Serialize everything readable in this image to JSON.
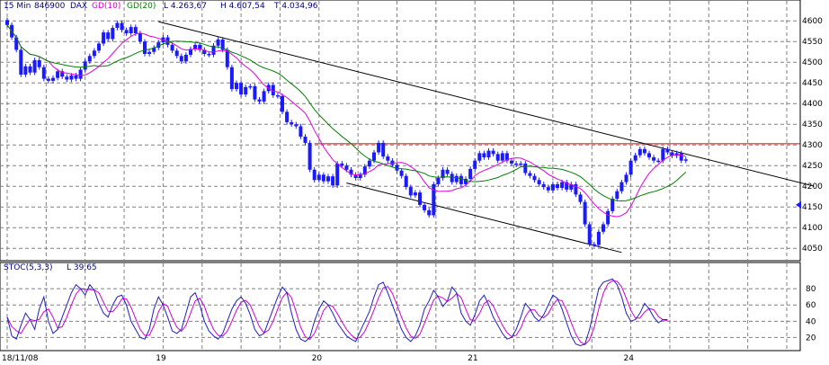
{
  "header": {
    "interval": "15 Min",
    "symbol_code": "846900",
    "symbol": "DAX",
    "ma1_label": "GD(10)",
    "ma2_label": "GD(20)",
    "low": "L  4.263,67",
    "high": "H  4.607,54",
    "low2": "T  4.034,96"
  },
  "oscillator_header": {
    "name": "STOC(5,3,3)",
    "value": "L  39,65"
  },
  "colors": {
    "price_bars": "#1a1aff",
    "ma_short": "#e000e0",
    "ma_long": "#008000",
    "resistance": "#e00000",
    "trend": "#000000",
    "grid": "#808080",
    "stoch_k": "#2020c0",
    "stoch_d": "#d000d0",
    "marker": "#1a1aff"
  },
  "chart_data": [
    {
      "type": "line",
      "panel": "price",
      "ylim": [
        4020,
        4620
      ],
      "y_ticks": [
        "4600",
        "4550",
        "4500",
        "4450",
        "4400",
        "4350",
        "4300",
        "4250",
        "4200",
        "4150",
        "4100",
        "4050"
      ],
      "y_tick_values": [
        4600,
        4550,
        4500,
        4450,
        4400,
        4350,
        4300,
        4250,
        4200,
        4150,
        4100,
        4050
      ],
      "x_ticks": [
        {
          "label": "18/11/08",
          "t": 0
        },
        {
          "label": "19",
          "t": 33
        },
        {
          "label": "20",
          "t": 67
        },
        {
          "label": "21",
          "t": 101
        },
        {
          "label": "24",
          "t": 135
        }
      ],
      "grid": true,
      "close": [
        4590,
        4560,
        4530,
        4470,
        4490,
        4475,
        4505,
        4488,
        4460,
        4455,
        4462,
        4478,
        4465,
        4458,
        4468,
        4460,
        4482,
        4502,
        4515,
        4528,
        4545,
        4572,
        4556,
        4583,
        4595,
        4578,
        4570,
        4585,
        4570,
        4550,
        4520,
        4525,
        4535,
        4548,
        4560,
        4542,
        4528,
        4515,
        4502,
        4518,
        4532,
        4542,
        4530,
        4520,
        4518,
        4540,
        4555,
        4530,
        4488,
        4435,
        4450,
        4422,
        4440,
        4442,
        4410,
        4405,
        4430,
        4445,
        4420,
        4418,
        4380,
        4355,
        4350,
        4345,
        4320,
        4305,
        4240,
        4215,
        4228,
        4212,
        4224,
        4202,
        4255,
        4250,
        4240,
        4228,
        4220,
        4228,
        4248,
        4262,
        4282,
        4305,
        4272,
        4262,
        4252,
        4238,
        4225,
        4198,
        4178,
        4185,
        4155,
        4142,
        4130,
        4205,
        4220,
        4240,
        4230,
        4210,
        4225,
        4205,
        4218,
        4242,
        4262,
        4280,
        4270,
        4286,
        4278,
        4262,
        4280,
        4262,
        4255,
        4252,
        4255,
        4232,
        4225,
        4215,
        4205,
        4198,
        4190,
        4205,
        4196,
        4210,
        4192,
        4205,
        4180,
        4162,
        4108,
        4060,
        4058,
        4090,
        4108,
        4140,
        4170,
        4188,
        4210,
        4228,
        4262,
        4275,
        4290,
        4280,
        4270,
        4262,
        4262,
        4290,
        4282,
        4274,
        4280,
        4262,
        4265
      ],
      "series": [
        {
          "name": "GD(10)"
        },
        {
          "name": "GD(20)"
        }
      ],
      "annotations": {
        "resistance_level": 4303,
        "channel_upper": {
          "from": {
            "t": 33,
            "y": 4598
          },
          "to": {
            "t": 176,
            "y": 4200
          }
        },
        "channel_lower": {
          "from": {
            "t": 74,
            "y": 4208
          },
          "to": {
            "t": 134,
            "y": 4040
          }
        },
        "last_marker": 4155
      }
    },
    {
      "type": "line",
      "panel": "oscillator",
      "ylim": [
        5,
        100
      ],
      "y_ticks": [
        "80",
        "60",
        "40",
        "20"
      ],
      "y_tick_values": [
        80,
        60,
        40,
        20
      ],
      "grid": true,
      "series": [
        {
          "name": "STOC(5,3,3)",
          "values": [
            45,
            22,
            18,
            35,
            50,
            42,
            30,
            55,
            70,
            40,
            25,
            30,
            45,
            60,
            75,
            85,
            80,
            72,
            85,
            78,
            62,
            50,
            45,
            60,
            70,
            72,
            60,
            40,
            30,
            20,
            18,
            30,
            55,
            70,
            60,
            45,
            28,
            25,
            30,
            50,
            70,
            75,
            60,
            40,
            28,
            22,
            18,
            25,
            40,
            55,
            65,
            70,
            62,
            48,
            30,
            22,
            25,
            40,
            55,
            70,
            82,
            75,
            50,
            30,
            18,
            15,
            20,
            40,
            55,
            65,
            60,
            50,
            38,
            30,
            22,
            18,
            15,
            28,
            40,
            52,
            70,
            85,
            88,
            75,
            60,
            45,
            30,
            20,
            15,
            22,
            35,
            55,
            65,
            78,
            70,
            58,
            65,
            82,
            75,
            50,
            40,
            35,
            48,
            65,
            72,
            60,
            45,
            35,
            25,
            18,
            20,
            30,
            45,
            62,
            55,
            45,
            40,
            48,
            60,
            72,
            68,
            55,
            38,
            22,
            12,
            10,
            12,
            30,
            55,
            80,
            88,
            90,
            92,
            85,
            70,
            50,
            40,
            42,
            50,
            62,
            55,
            45,
            38,
            42,
            42
          ]
        }
      ]
    }
  ]
}
